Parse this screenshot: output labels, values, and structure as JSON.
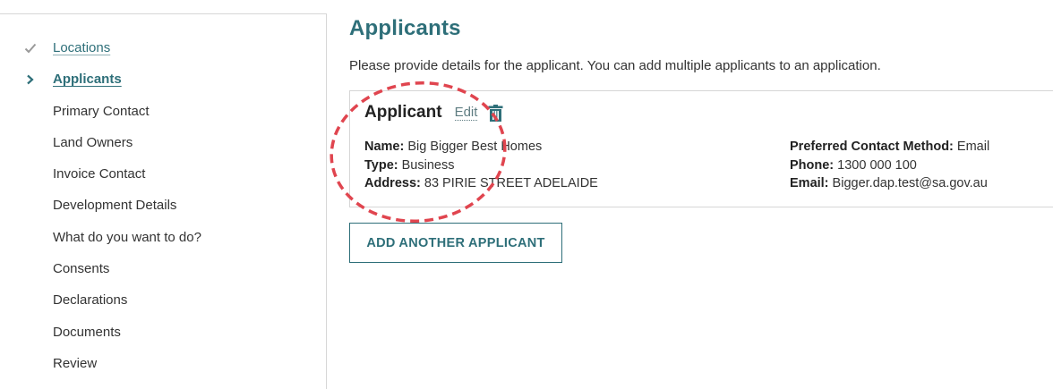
{
  "sidebar": {
    "items": [
      {
        "label": "Locations",
        "state": "done",
        "icon": "check-icon"
      },
      {
        "label": "Applicants",
        "state": "active",
        "icon": "chevron-right-icon"
      },
      {
        "label": "Primary Contact",
        "state": "pending"
      },
      {
        "label": "Land Owners",
        "state": "pending"
      },
      {
        "label": "Invoice Contact",
        "state": "pending"
      },
      {
        "label": "Development Details",
        "state": "pending"
      },
      {
        "label": "What do you want to do?",
        "state": "pending"
      },
      {
        "label": "Consents",
        "state": "pending"
      },
      {
        "label": "Declarations",
        "state": "pending"
      },
      {
        "label": "Documents",
        "state": "pending"
      },
      {
        "label": "Review",
        "state": "pending"
      }
    ]
  },
  "main": {
    "title": "Applicants",
    "intro": "Please provide details for the applicant. You can add multiple applicants to an application.",
    "applicant_card": {
      "title": "Applicant",
      "edit_label": "Edit",
      "delete_icon": "trash-icon",
      "name_label": "Name:",
      "name_value": "Big Bigger Best Homes",
      "type_label": "Type:",
      "type_value": "Business",
      "address_label": "Address:",
      "address_value": "83 PIRIE STREET ADELAIDE",
      "contact_method_label": "Preferred Contact Method:",
      "contact_method_value": "Email",
      "phone_label": "Phone:",
      "phone_value": "1300 000 100",
      "email_label": "Email:",
      "email_value": "Bigger.dap.test@sa.gov.au"
    },
    "add_button_label": "ADD ANOTHER APPLICANT"
  },
  "colors": {
    "accent": "#2e6f79",
    "border": "#d6d6d6",
    "annotation": "#e0454f",
    "check": "#9a9a9a"
  }
}
